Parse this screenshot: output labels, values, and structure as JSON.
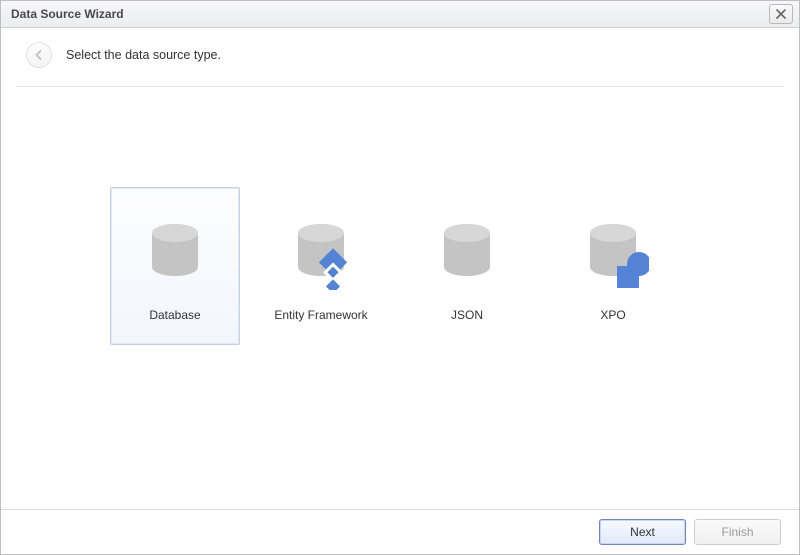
{
  "window": {
    "title": "Data Source Wizard"
  },
  "header": {
    "instruction": "Select the data source type."
  },
  "options": [
    {
      "label": "Database",
      "selected": true
    },
    {
      "label": "Entity Framework",
      "selected": false
    },
    {
      "label": "JSON",
      "selected": false
    },
    {
      "label": "XPO",
      "selected": false
    }
  ],
  "buttons": {
    "next": "Next",
    "finish": "Finish"
  },
  "colors": {
    "cylinder": "#c4c4c4",
    "cylinder_top": "#d7d7d7",
    "overlay": "#5482d4"
  }
}
